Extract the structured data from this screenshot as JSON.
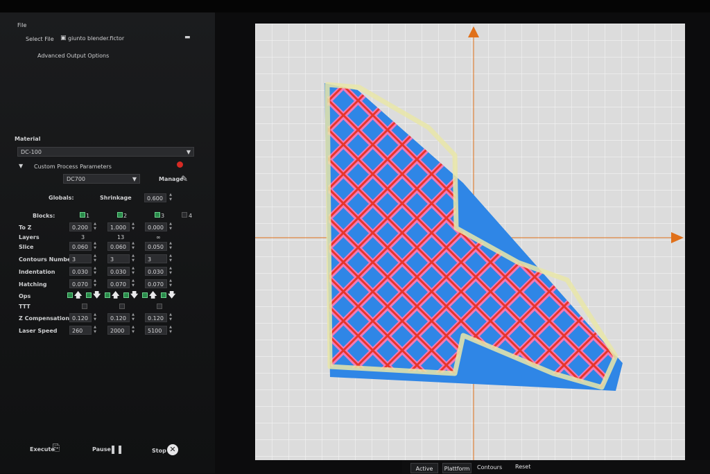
{
  "menu": {
    "file": "File"
  },
  "file_section": {
    "select_file_label": "Select File",
    "file_name": "giunto blender.fictor",
    "advanced_output": "Advanced Output Options"
  },
  "material": {
    "title": "Material",
    "selected": "DC-100",
    "custom_params": "Custom Process Parameters",
    "preset": "DC700",
    "manage": "Manage",
    "globals": "Globals:",
    "shrinkage_label": "Shrinkage",
    "shrinkage_value": "0.600",
    "blocks_label": "Blocks:",
    "blocks": [
      "1",
      "2",
      "3",
      "4"
    ],
    "rows": [
      {
        "label": "To Z",
        "values": [
          "0.200",
          "1.000",
          "0.000"
        ]
      },
      {
        "label": "Layers",
        "values": [
          "3",
          "13",
          "∞"
        ]
      },
      {
        "label": "Slice",
        "values": [
          "0.060",
          "0.060",
          "0.050"
        ]
      },
      {
        "label": "Contours Number",
        "values": [
          "3",
          "3",
          "3"
        ]
      },
      {
        "label": "Indentation",
        "values": [
          "0.030",
          "0.030",
          "0.030"
        ]
      },
      {
        "label": "Hatching",
        "values": [
          "0.070",
          "0.070",
          "0.070"
        ]
      },
      {
        "label": "Ops",
        "values": []
      },
      {
        "label": "TTT",
        "values": []
      },
      {
        "label": "Z Compensation",
        "values": [
          "0.120",
          "0.120",
          "0.120"
        ]
      },
      {
        "label": "Laser Speed",
        "values": [
          "260",
          "2000",
          "5100"
        ]
      }
    ]
  },
  "actions": {
    "execute": "Execute",
    "pause": "Pause",
    "stop": "Stop"
  },
  "toolbar": {
    "active": "Active",
    "platform": "Plattform",
    "contours": "Contours",
    "reset": "Reset"
  },
  "colors": {
    "accent_orange": "#e0701a",
    "part_blue": "#2f86e6",
    "lattice_pink": "#f07ab8",
    "lattice_red": "#e8352a",
    "contour_yellow": "#e9e6a8"
  }
}
